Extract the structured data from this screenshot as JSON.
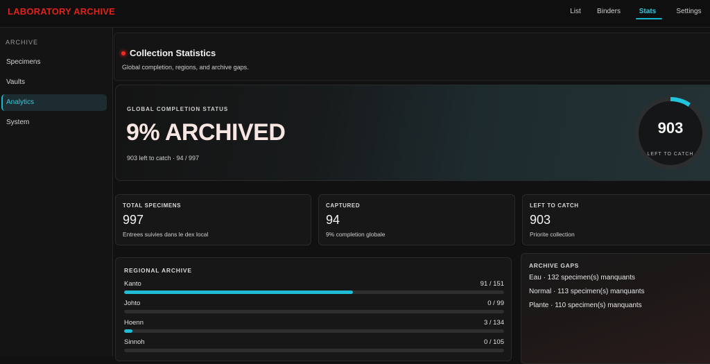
{
  "app": {
    "title": "LABORATORY ARCHIVE"
  },
  "nav": {
    "items": [
      {
        "label": "List"
      },
      {
        "label": "Binders"
      },
      {
        "label": "Stats"
      },
      {
        "label": "Settings"
      }
    ],
    "active": "Stats"
  },
  "sidebar": {
    "section": "ARCHIVE",
    "items": [
      {
        "label": "Specimens"
      },
      {
        "label": "Vaults"
      },
      {
        "label": "Analytics"
      },
      {
        "label": "System"
      }
    ],
    "active": "Analytics"
  },
  "header": {
    "title": "Collection Statistics",
    "subtitle": "Global completion, regions, and archive gaps."
  },
  "hero": {
    "label": "GLOBAL COMPLETION STATUS",
    "headline": "9% ARCHIVED",
    "sub": "903 left to catch · 94 / 997",
    "ring_value": "903",
    "ring_label": "LEFT TO CATCH",
    "ring_progress": 0.094
  },
  "stats": [
    {
      "label": "TOTAL SPECIMENS",
      "value": "997",
      "sub": "Entrees suivies dans le dex local"
    },
    {
      "label": "CAPTURED",
      "value": "94",
      "sub": "9% completion globale"
    },
    {
      "label": "LEFT TO CATCH",
      "value": "903",
      "sub": "Priorite collection"
    }
  ],
  "regions": {
    "title": "REGIONAL ARCHIVE",
    "items": [
      {
        "name": "Kanto",
        "count": "91 / 151",
        "progress": 0.6026
      },
      {
        "name": "Johto",
        "count": "0 / 99",
        "progress": 0
      },
      {
        "name": "Hoenn",
        "count": "3 / 134",
        "progress": 0.0224
      },
      {
        "name": "Sinnoh",
        "count": "0 / 105",
        "progress": 0
      }
    ]
  },
  "gaps": {
    "title": "ARCHIVE GAPS",
    "items": [
      {
        "text": "Eau · 132 specimen(s) manquants"
      },
      {
        "text": "Normal · 113 specimen(s) manquants"
      },
      {
        "text": "Plante · 110 specimen(s) manquants"
      }
    ]
  },
  "colors": {
    "brand": "#e0231b",
    "accent": "#1fbcd4",
    "rec_dot": "#ef2a22"
  }
}
